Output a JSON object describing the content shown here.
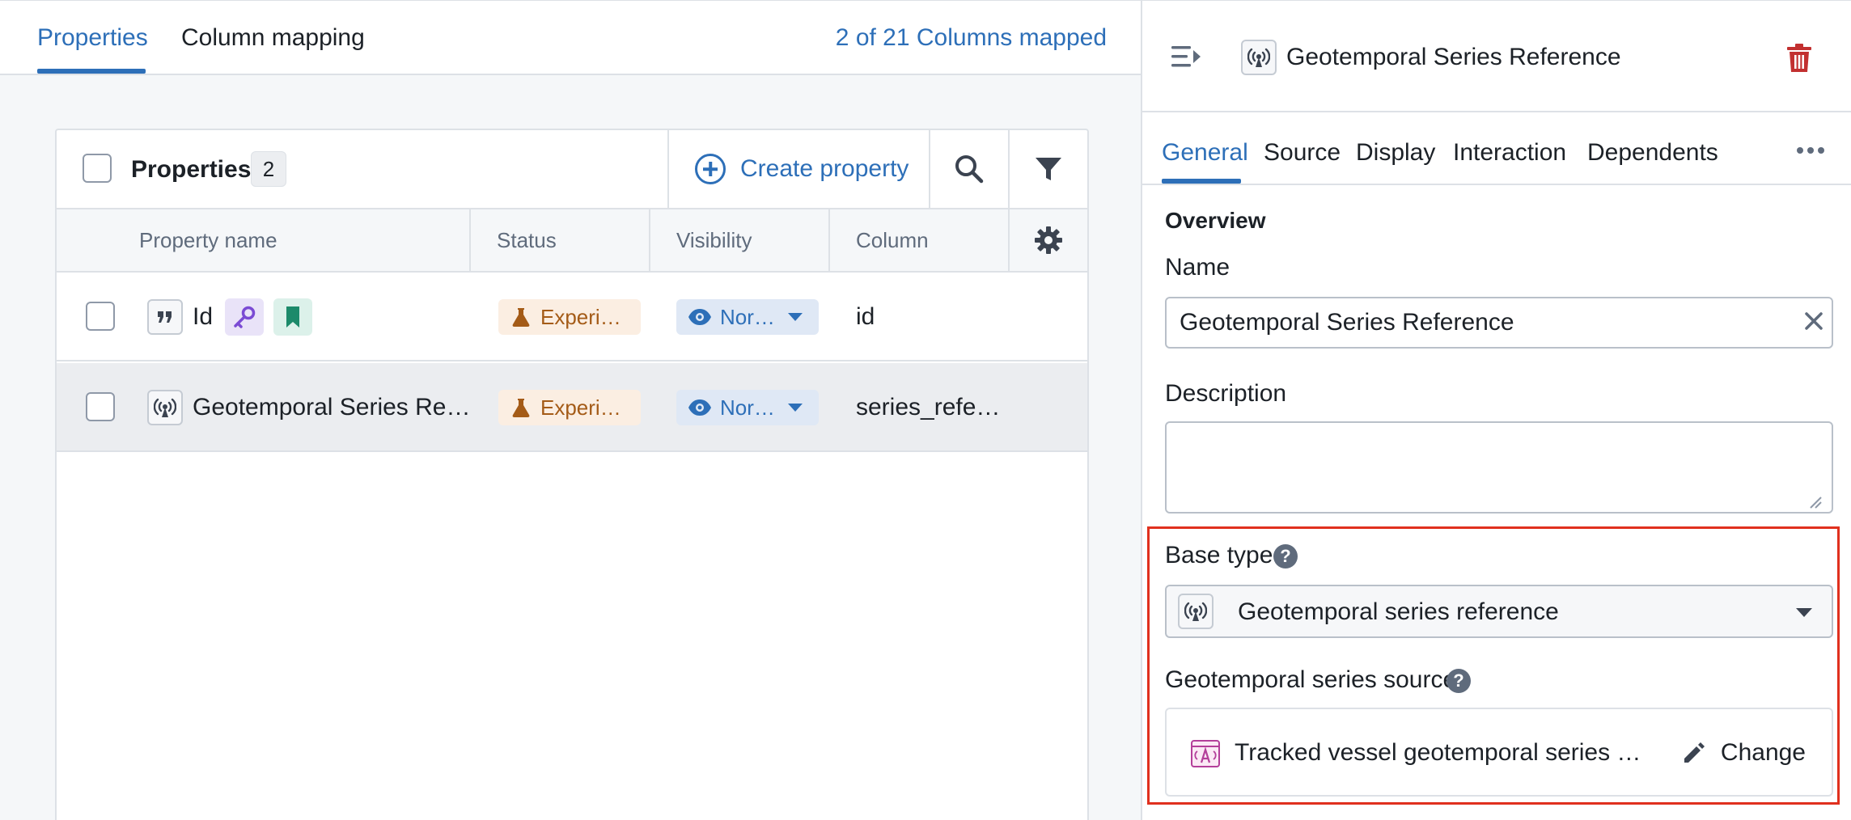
{
  "left_tabs": [
    {
      "label": "Properties",
      "active": true
    },
    {
      "label": "Column mapping",
      "active": false
    }
  ],
  "columns_mapped": "2 of 21 Columns mapped",
  "table": {
    "title": "Properties",
    "count": "2",
    "create_label": "Create property",
    "headers": [
      "Property name",
      "Status",
      "Visibility",
      "Column"
    ],
    "rows": [
      {
        "name": "Id",
        "status": "Experi…",
        "visibility": "Nor…",
        "column": "id",
        "type_icon": "quote-icon",
        "tags": [
          "key-icon",
          "bookmark-icon"
        ],
        "selected": false
      },
      {
        "name": "Geotemporal Series Re…",
        "status": "Experi…",
        "visibility": "Nor…",
        "column": "series_refe…",
        "type_icon": "broadcast-icon",
        "tags": [],
        "selected": true
      }
    ]
  },
  "panel": {
    "title": "Geotemporal Series Reference",
    "tabs": [
      {
        "label": "General",
        "active": true
      },
      {
        "label": "Source",
        "active": false
      },
      {
        "label": "Display",
        "active": false
      },
      {
        "label": "Interaction",
        "active": false
      },
      {
        "label": "Dependents",
        "active": false
      }
    ],
    "overview_label": "Overview",
    "name_label": "Name",
    "name_value": "Geotemporal Series Reference",
    "description_label": "Description",
    "description_value": "",
    "base_type_label": "Base type",
    "base_type_help": "?",
    "base_type_value": "Geotemporal series reference",
    "source_label": "Geotemporal series source",
    "source_help": "?",
    "source_value": "Tracked vessel geotemporal series …",
    "change_label": "Change"
  },
  "colors": {
    "accent": "#2d6fb8",
    "status_bg": "#fbeee2",
    "status_text": "#a45b17",
    "key_bg": "#e9e3f8",
    "key_icon": "#7b4bd4",
    "bookmark_bg": "#dcf1ea",
    "bookmark_icon": "#1c8a6a",
    "delete": "#c23030",
    "highlight": "#e0301e"
  }
}
